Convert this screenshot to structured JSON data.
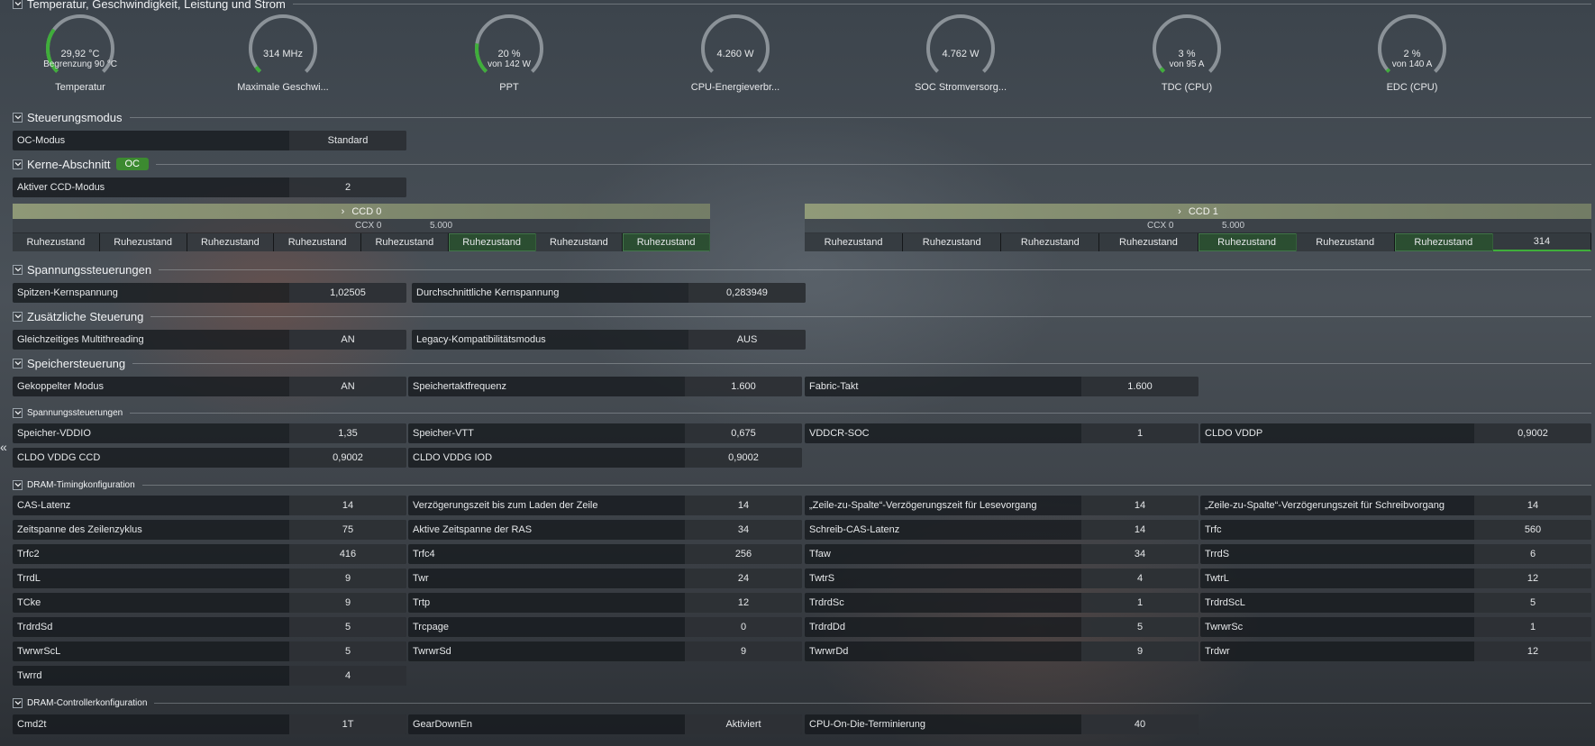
{
  "sections": {
    "temp": "Temperatur, Geschwindigkeit, Leistung und Strom",
    "steuerung": "Steuerungsmodus",
    "kerne": "Kerne-Abschnitt",
    "kerne_badge": "OC",
    "spannung": "Spannungssteuerungen",
    "zusatz": "Zusätzliche Steuerung",
    "speicher": "Speichersteuerung",
    "mem_spannung": "Spannungssteuerungen",
    "dram_timing": "DRAM-Timingkonfiguration",
    "dram_ctrl": "DRAM-Controllerkonfiguration"
  },
  "gauges": [
    {
      "value": "29,92 °C",
      "sub": "Begrenzung 90 °C",
      "name": "Temperatur",
      "fill": 0.3
    },
    {
      "value": "314  MHz",
      "sub": "",
      "name": "Maximale Geschwi...",
      "fill": 0.04
    },
    {
      "value": "20 %",
      "sub": "von 142 W",
      "name": "PPT",
      "fill": 0.2
    },
    {
      "value": "4.260 W",
      "sub": "",
      "name": "CPU-Energieverbr...",
      "fill": 0.0
    },
    {
      "value": "4.762 W",
      "sub": "",
      "name": "SOC Stromversorg...",
      "fill": 0.0
    },
    {
      "value": "3 %",
      "sub": "von 95 A",
      "name": "TDC (CPU)",
      "fill": 0.03
    },
    {
      "value": "2 %",
      "sub": "von 140 A",
      "name": "EDC (CPU)",
      "fill": 0.02
    }
  ],
  "colors": {
    "accent": "#3fae3a",
    "gauge_track": "#8b9298"
  },
  "oc_modus": {
    "label": "OC-Modus",
    "value": "Standard"
  },
  "ccd_modus": {
    "label": "Aktiver CCD-Modus",
    "value": "2"
  },
  "ccd": [
    {
      "title": "CCD 0",
      "ccx": "CCX 0",
      "clock": "5.000",
      "cores": [
        "Ruhezustand",
        "Ruhezustand",
        "Ruhezustand",
        "Ruhezustand",
        "Ruhezustand",
        "Ruhezustand",
        "Ruhezustand",
        "Ruhezustand"
      ]
    },
    {
      "title": "CCD 1",
      "ccx": "CCX 0",
      "clock": "5.000",
      "cores": [
        "Ruhezustand",
        "Ruhezustand",
        "Ruhezustand",
        "Ruhezustand",
        "Ruhezustand",
        "Ruhezustand",
        "Ruhezustand",
        "314"
      ]
    }
  ],
  "spannung": [
    {
      "label": "Spitzen-Kernspannung",
      "value": "1,02505"
    },
    {
      "label": "Durchschnittliche Kernspannung",
      "value": "0,283949"
    }
  ],
  "zusatz": [
    {
      "label": "Gleichzeitiges Multithreading",
      "value": "AN"
    },
    {
      "label": "Legacy-Kompatibilitätsmodus",
      "value": "AUS"
    }
  ],
  "speicher": [
    {
      "label": "Gekoppelter Modus",
      "value": "AN"
    },
    {
      "label": "Speichertaktfrequenz",
      "value": "1.600"
    },
    {
      "label": "Fabric-Takt",
      "value": "1.600"
    }
  ],
  "mem_spannung": [
    {
      "label": "Speicher-VDDIO",
      "value": "1,35"
    },
    {
      "label": "Speicher-VTT",
      "value": "0,675"
    },
    {
      "label": "VDDCR-SOC",
      "value": "1"
    },
    {
      "label": "CLDO VDDP",
      "value": "0,9002"
    },
    {
      "label": "CLDO VDDG CCD",
      "value": "0,9002"
    },
    {
      "label": "CLDO VDDG IOD",
      "value": "0,9002"
    }
  ],
  "timings": [
    {
      "label": "CAS-Latenz",
      "value": "14"
    },
    {
      "label": "Verzögerungszeit bis zum Laden der Zeile",
      "value": "14"
    },
    {
      "label": "„Zeile-zu-Spalte“-Verzögerungszeit für Lesevorgang",
      "value": "14"
    },
    {
      "label": "„Zeile-zu-Spalte“-Verzögerungszeit für Schreibvorgang",
      "value": "14"
    },
    {
      "label": "Zeitspanne des Zeilenzyklus",
      "value": "75"
    },
    {
      "label": "Aktive Zeitspanne der RAS",
      "value": "34"
    },
    {
      "label": "Schreib-CAS-Latenz",
      "value": "14"
    },
    {
      "label": "Trfc",
      "value": "560"
    },
    {
      "label": "Trfc2",
      "value": "416"
    },
    {
      "label": "Trfc4",
      "value": "256"
    },
    {
      "label": "Tfaw",
      "value": "34"
    },
    {
      "label": "TrrdS",
      "value": "6"
    },
    {
      "label": "TrrdL",
      "value": "9"
    },
    {
      "label": "Twr",
      "value": "24"
    },
    {
      "label": "TwtrS",
      "value": "4"
    },
    {
      "label": "TwtrL",
      "value": "12"
    },
    {
      "label": "TCke",
      "value": "9"
    },
    {
      "label": "Trtp",
      "value": "12"
    },
    {
      "label": "TrdrdSc",
      "value": "1"
    },
    {
      "label": "TrdrdScL",
      "value": "5"
    },
    {
      "label": "TrdrdSd",
      "value": "5"
    },
    {
      "label": "Trcpage",
      "value": "0"
    },
    {
      "label": "TrdrdDd",
      "value": "5"
    },
    {
      "label": "TwrwrSc",
      "value": "1"
    },
    {
      "label": "TwrwrScL",
      "value": "5"
    },
    {
      "label": "TwrwrSd",
      "value": "9"
    },
    {
      "label": "TwrwrDd",
      "value": "9"
    },
    {
      "label": "Trdwr",
      "value": "12"
    },
    {
      "label": "Twrrd",
      "value": "4"
    }
  ],
  "controller": [
    {
      "label": "Cmd2t",
      "value": "1T"
    },
    {
      "label": "GearDownEn",
      "value": "Aktiviert"
    },
    {
      "label": "CPU-On-Die-Terminierung",
      "value": "40"
    }
  ]
}
